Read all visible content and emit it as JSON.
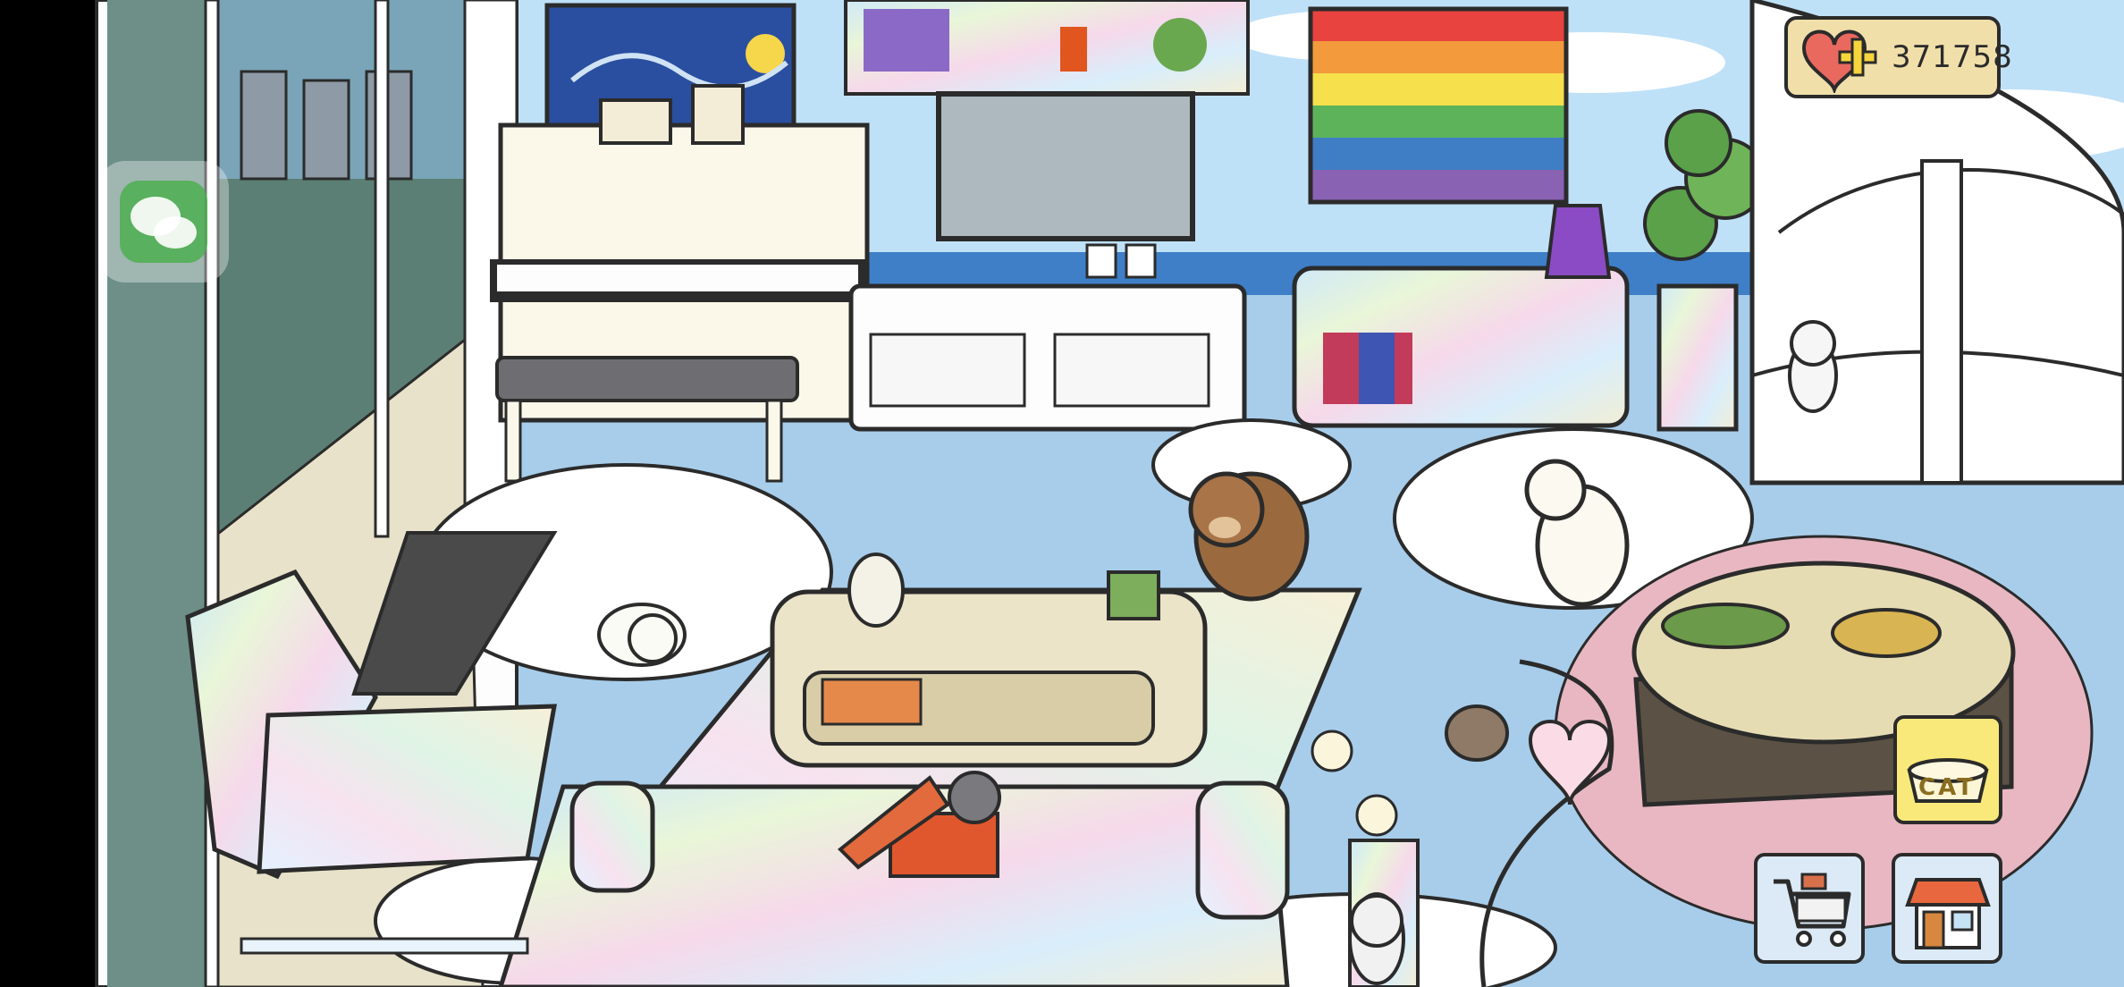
{
  "hud": {
    "coins": "371758",
    "cat_button_label": "CAT"
  },
  "icons": {
    "coin_icon": "heart-plus-icon",
    "wechat": "wechat-icon",
    "cat_food": "cat-food-bowl-icon",
    "cart": "shopping-cart-icon",
    "shop": "shop-house-icon"
  },
  "colors": {
    "coin_panel": "#f1dfaa",
    "heart": "#e9695f",
    "plus": "#f6d43c",
    "cat_button": "#f9e97a",
    "nav_buttons": "#dbeaf6",
    "floor": "#a7cdea",
    "sky": "#bfe1f7",
    "sea": "#3e7fc8",
    "outline": "#2b2b2b"
  }
}
